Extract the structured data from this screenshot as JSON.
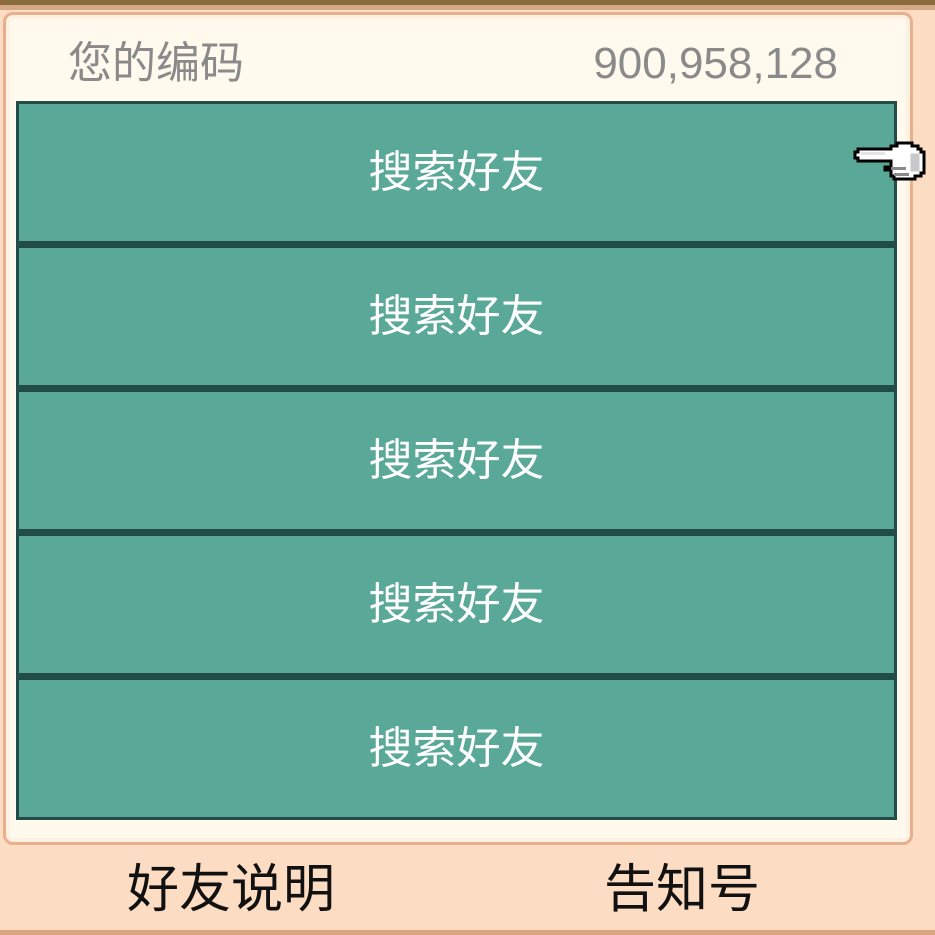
{
  "header": {
    "code_label": "您的编码",
    "code_value": "900,958,128"
  },
  "list": {
    "rows": [
      {
        "label": "搜索好友"
      },
      {
        "label": "搜索好友"
      },
      {
        "label": "搜索好友"
      },
      {
        "label": "搜索好友"
      },
      {
        "label": "搜索好友"
      }
    ]
  },
  "footer": {
    "left_label": "好友说明",
    "right_label": "告知号"
  },
  "icons": {
    "cursor": "pointing-hand-cursor-icon"
  },
  "colors": {
    "background": "#fcdcc2",
    "top_bar": "#8a6b3b",
    "panel": "#fff9ee",
    "panel_border": "#e6b08e",
    "row": "#5aa898",
    "row_border": "#224d47",
    "row_text": "#ffffff",
    "header_text": "#8a8a8a",
    "footer_text": "#111111"
  }
}
